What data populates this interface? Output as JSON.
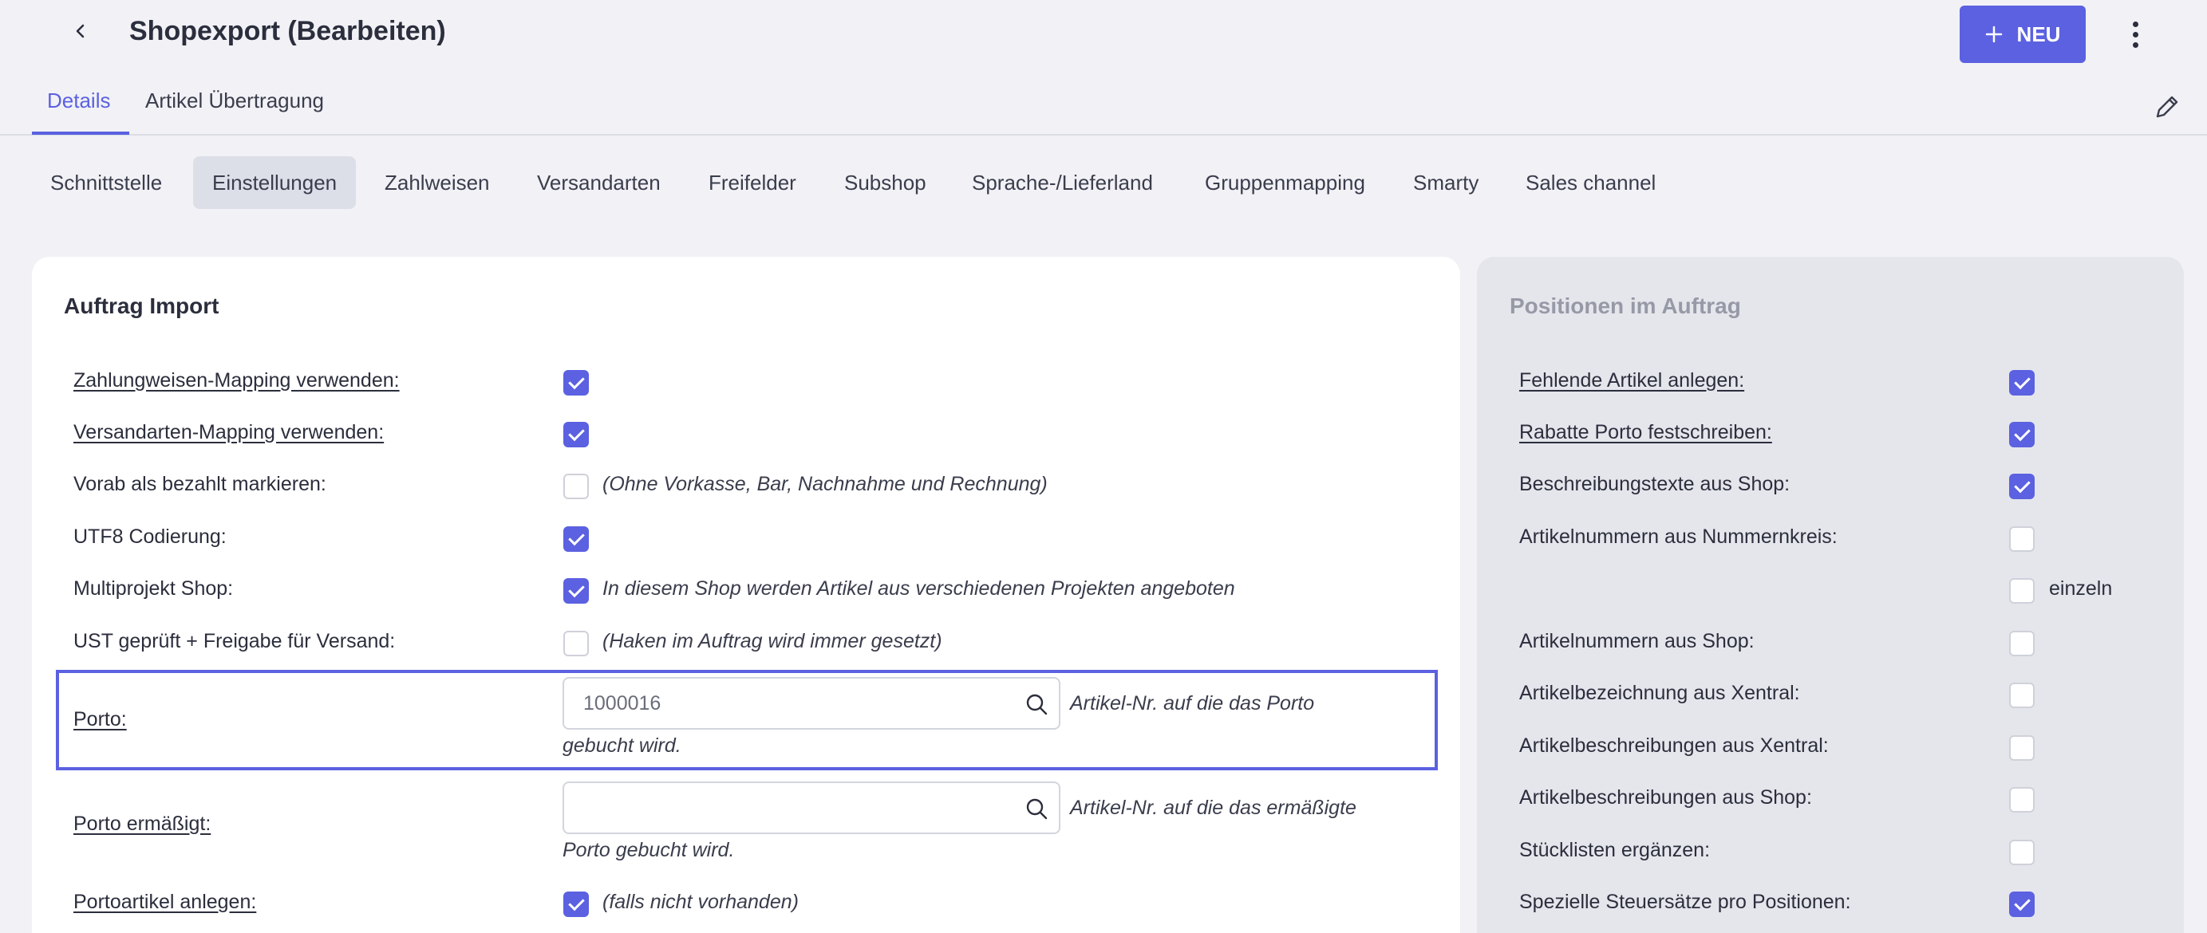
{
  "header": {
    "title": "Shopexport (Bearbeiten)",
    "new_button_label": "NEU",
    "tabs": [
      {
        "label": "Details",
        "active": true
      },
      {
        "label": "Artikel Übertragung",
        "active": false
      }
    ]
  },
  "subnav": {
    "items": [
      "Schnittstelle",
      "Einstellungen",
      "Zahlweisen",
      "Versandarten",
      "Freifelder",
      "Subshop",
      "Sprache-/Lieferland",
      "Gruppenmapping",
      "Smarty",
      "Sales channel"
    ],
    "active": "Einstellungen"
  },
  "left_panel": {
    "title": "Auftrag Import",
    "rows": [
      {
        "label": "Zahlungweisen-Mapping verwenden:",
        "checked": true,
        "note": ""
      },
      {
        "label": "Versandarten-Mapping verwenden:",
        "checked": true,
        "note": ""
      },
      {
        "label": "Vorab als bezahlt markieren:",
        "checked": false,
        "note": "(Ohne Vorkasse, Bar, Nachnahme und Rechnung)"
      },
      {
        "label": "UTF8 Codierung:",
        "checked": true,
        "note": ""
      },
      {
        "label": "Multiprojekt Shop:",
        "checked": true,
        "note": "In diesem Shop werden Artikel aus verschiedenen Projekten angeboten"
      },
      {
        "label": "UST geprüft + Freigabe für Versand:",
        "checked": false,
        "note": "(Haken im Auftrag wird immer gesetzt)"
      }
    ],
    "porto": {
      "label": "Porto:",
      "value": "1000016",
      "note_line1": "Artikel-Nr. auf die das Porto",
      "note_line2": "gebucht wird."
    },
    "porto_ermaessigt": {
      "label": "Porto ermäßigt:",
      "value": "",
      "note_line1": "Artikel-Nr. auf die das ermäßigte",
      "note_line2": "Porto gebucht wird."
    },
    "portoartikel": {
      "label": "Portoartikel anlegen:",
      "checked": true,
      "note": "(falls nicht vorhanden)"
    }
  },
  "right_panel": {
    "title": "Positionen im Auftrag",
    "rows": [
      {
        "label": "Fehlende Artikel anlegen:",
        "checked": true
      },
      {
        "label": "Rabatte Porto festschreiben:",
        "checked": true
      },
      {
        "label": "Beschreibungstexte aus Shop:",
        "checked": true
      },
      {
        "label": "Artikelnummern aus Nummernkreis:",
        "checked": false
      },
      {
        "label": "Artikelnummern aus Shop:",
        "checked": false
      },
      {
        "label": "Artikelbezeichnung aus Xentral:",
        "checked": false
      },
      {
        "label": "Artikelbeschreibungen aus Xentral:",
        "checked": false
      },
      {
        "label": "Artikelbeschreibungen aus Shop:",
        "checked": false
      },
      {
        "label": "Stücklisten ergänzen:",
        "checked": false
      },
      {
        "label": "Spezielle Steuersätze pro Positionen:",
        "checked": true
      }
    ],
    "einzeln": {
      "label": "einzeln",
      "checked": false
    }
  },
  "colors": {
    "accent": "#5b61e0",
    "background": "#f1f1f6",
    "panel": "#ffffff",
    "panel_muted": "#e5e6ec"
  }
}
